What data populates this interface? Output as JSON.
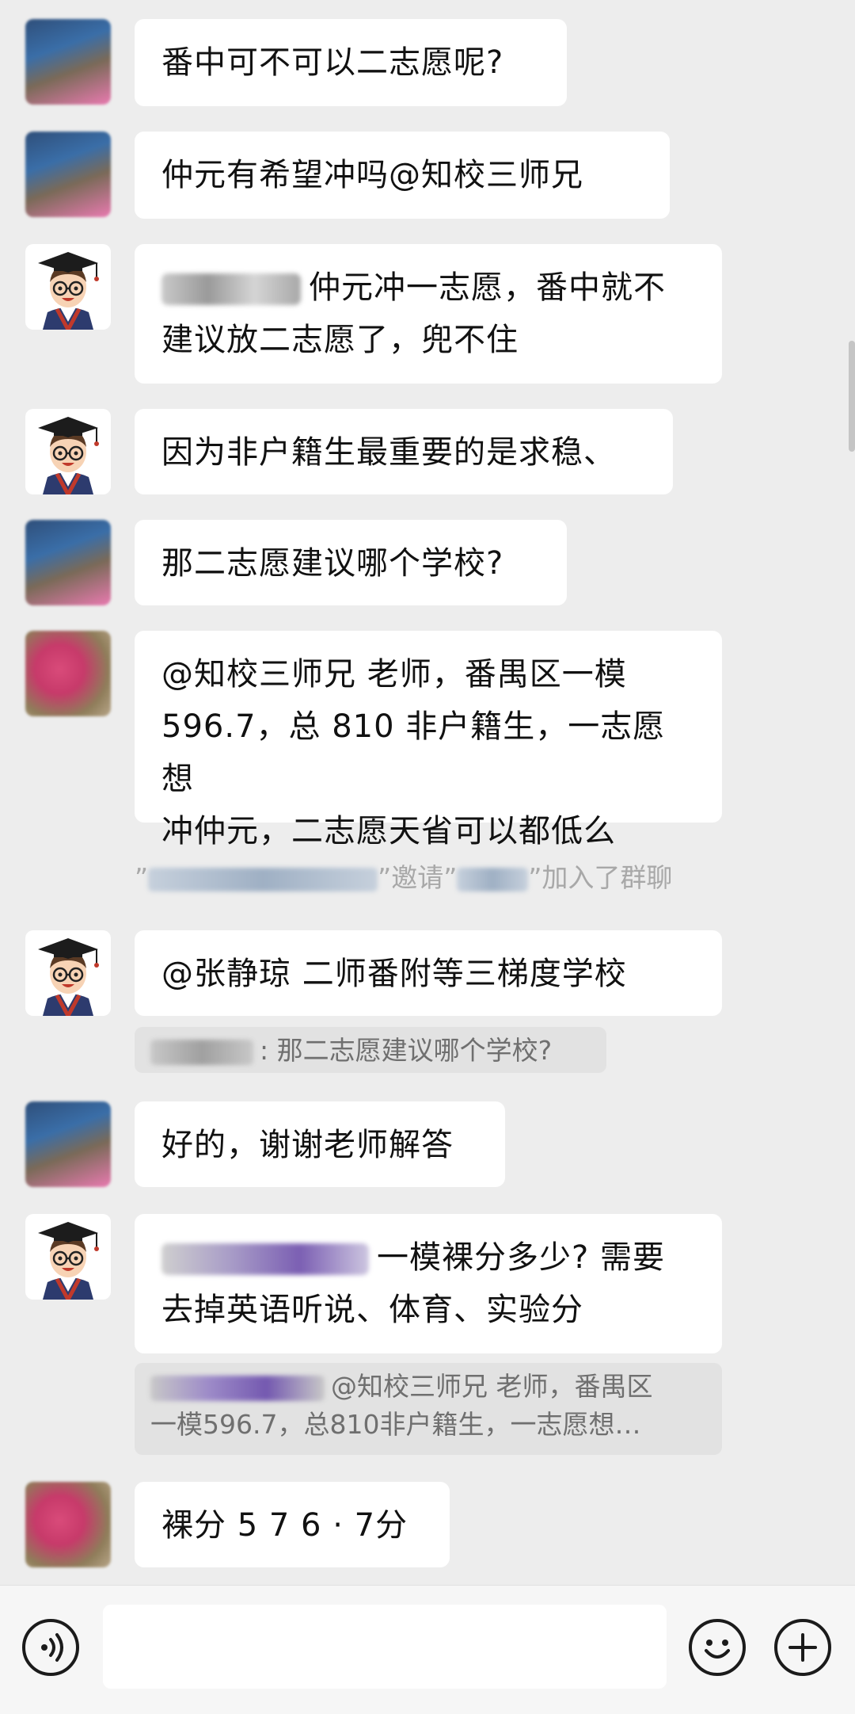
{
  "messages": [
    {
      "text": "番中可不可以二志愿呢?"
    },
    {
      "text": "仲元有希望冲吗@知校三师兄"
    },
    {
      "line1": "仲元冲一志愿，番中就不",
      "line2": "建议放二志愿了，兜不住"
    },
    {
      "text": "因为非户籍生最重要的是求稳、"
    },
    {
      "text": "那二志愿建议哪个学校?"
    },
    {
      "line1": "@知校三师兄  老师，番禺区一模",
      "line2": "596.7，总 810 非户籍生，一志愿想",
      "line3": "冲仲元，二志愿天省可以都低么"
    },
    {
      "text": "@张静琼 二师番附等三梯度学校"
    },
    {
      "text": "好的，谢谢老师解答"
    },
    {
      "line1": "一模裸分多少? 需要",
      "line2": "去掉英语听说、体育、实验分"
    },
    {
      "text": "裸分 5 7 6 · 7分"
    }
  ],
  "system_notice": {
    "q1": "”",
    "q2": "”邀请”",
    "q3": "”加入了群聊"
  },
  "quotes": [
    {
      "text": ": 那二志愿建议哪个学校?"
    },
    {
      "line1": "@知校三师兄 老师，番禺区",
      "line2": "一模596.7，总810非户籍生，一志愿想…"
    }
  ],
  "icons": {
    "voice": "voice-icon",
    "emoji": "emoji-icon",
    "plus": "plus-icon",
    "teacher_avatar": "graduate-avatar-icon"
  }
}
